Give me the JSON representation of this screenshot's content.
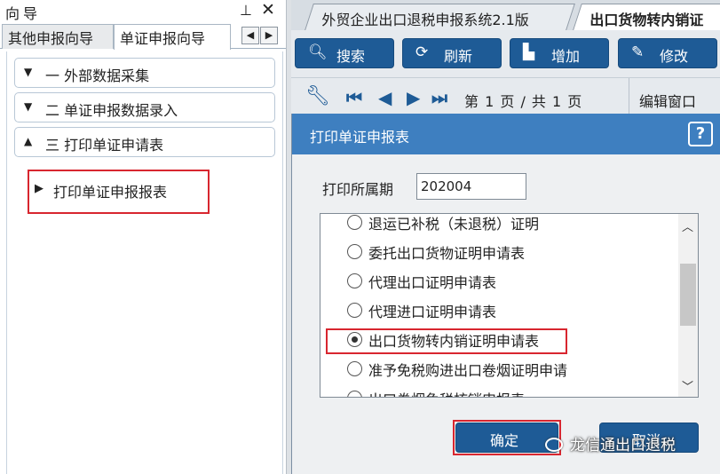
{
  "left_pane": {
    "title": "向导",
    "tabs": [
      "其他申报向导",
      "单证申报向导"
    ],
    "sections": [
      {
        "arrow": "▼",
        "label": "一 外部数据采集"
      },
      {
        "arrow": "▼",
        "label": "二 单证申报数据录入"
      },
      {
        "arrow": "▲",
        "label": "三 打印单证申请表"
      }
    ],
    "leaf_item": "打印单证申报报表"
  },
  "doc_tabs": [
    "外贸企业出口退税申报系统2.1版",
    "出口货物转内销证"
  ],
  "toolbar": {
    "search": "搜索",
    "refresh": "刷新",
    "add": "增加",
    "edit": "修改"
  },
  "pager": {
    "page_info": "第 1 页 / 共 1 页",
    "edit_window": "编辑窗口"
  },
  "dialog": {
    "title": "打印单证申报表",
    "help": "?",
    "period_label": "打印所属期",
    "period_value": "202004",
    "options": [
      "退运已补税（未退税）证明",
      "委托出口货物证明申请表",
      "代理出口证明申请表",
      "代理进口证明申请表",
      "出口货物转内销证明申请表",
      "准予免税购进出口卷烟证明申请",
      "出口卷烟免税核销申报表"
    ],
    "selected_index": 4,
    "ok": "确定",
    "cancel": "取消"
  },
  "watermark": "龙信通出口退税",
  "colors": {
    "accent": "#1e5b96",
    "dialog_title": "#3e7fc0",
    "highlight": "#d8262f"
  }
}
